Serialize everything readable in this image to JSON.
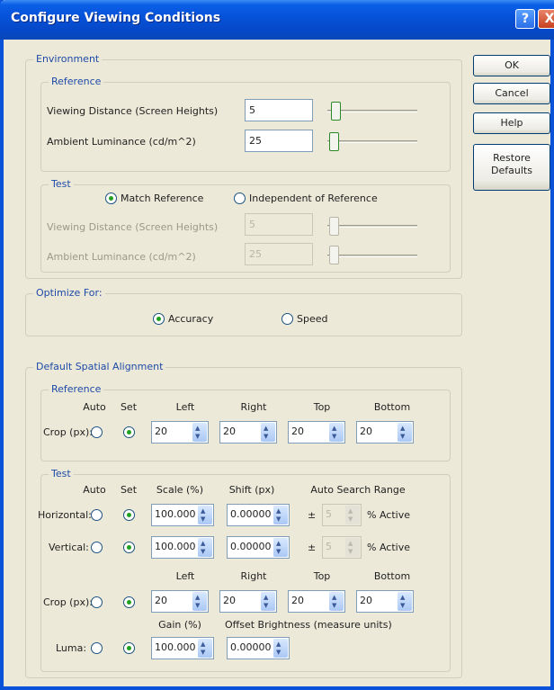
{
  "window": {
    "title": "Configure Viewing Conditions"
  },
  "titlebar_buttons": {
    "help": "?",
    "close": "X"
  },
  "buttons": {
    "ok": "OK",
    "cancel": "Cancel",
    "help": "Help",
    "restore_line1": "Restore",
    "restore_line2": "Defaults"
  },
  "environment": {
    "label": "Environment",
    "reference": {
      "label": "Reference",
      "viewing_distance_label": "Viewing Distance (Screen Heights)",
      "viewing_distance_value": "5",
      "ambient_luminance_label": "Ambient Luminance (cd/m^2)",
      "ambient_luminance_value": "25"
    },
    "test": {
      "label": "Test",
      "match_reference": "Match Reference",
      "independent": "Independent of Reference",
      "viewing_distance_label": "Viewing Distance (Screen Heights)",
      "viewing_distance_value": "5",
      "ambient_luminance_label": "Ambient Luminance (cd/m^2)",
      "ambient_luminance_value": "25"
    }
  },
  "optimize": {
    "label": "Optimize For:",
    "accuracy": "Accuracy",
    "speed": "Speed",
    "selected": "accuracy"
  },
  "alignment": {
    "label": "Default Spatial Alignment",
    "reference": {
      "label": "Reference",
      "col_auto": "Auto",
      "col_set": "Set",
      "col_left": "Left",
      "col_right": "Right",
      "col_top": "Top",
      "col_bottom": "Bottom",
      "crop_label": "Crop (px):",
      "crop_values": [
        "20",
        "20",
        "20",
        "20"
      ]
    },
    "test": {
      "label": "Test",
      "col_auto": "Auto",
      "col_set": "Set",
      "col_scale": "Scale (%)",
      "col_shift": "Shift (px)",
      "col_search": "Auto Search Range",
      "horizontal_label": "Horizontal:",
      "horizontal_scale": "100.000",
      "horizontal_shift": "0.00000",
      "vertical_label": "Vertical:",
      "vertical_scale": "100.000",
      "vertical_shift": "0.00000",
      "plus_minus": "±",
      "range_value": "5",
      "active_label": "% Active",
      "col_left": "Left",
      "col_right": "Right",
      "col_top": "Top",
      "col_bottom": "Bottom",
      "crop_label": "Crop (px):",
      "crop_values": [
        "20",
        "20",
        "20",
        "20"
      ],
      "col_gain": "Gain (%)",
      "col_offset": "Offset Brightness (measure units)",
      "luma_label": "Luma:",
      "gain_value": "100.000",
      "offset_value": "0.00000"
    }
  },
  "colors": {
    "title_bar": "#0551d8",
    "group_label": "#1e4aa8",
    "radio_dot": "#21a121",
    "dialog_face": "#ece9d8"
  }
}
